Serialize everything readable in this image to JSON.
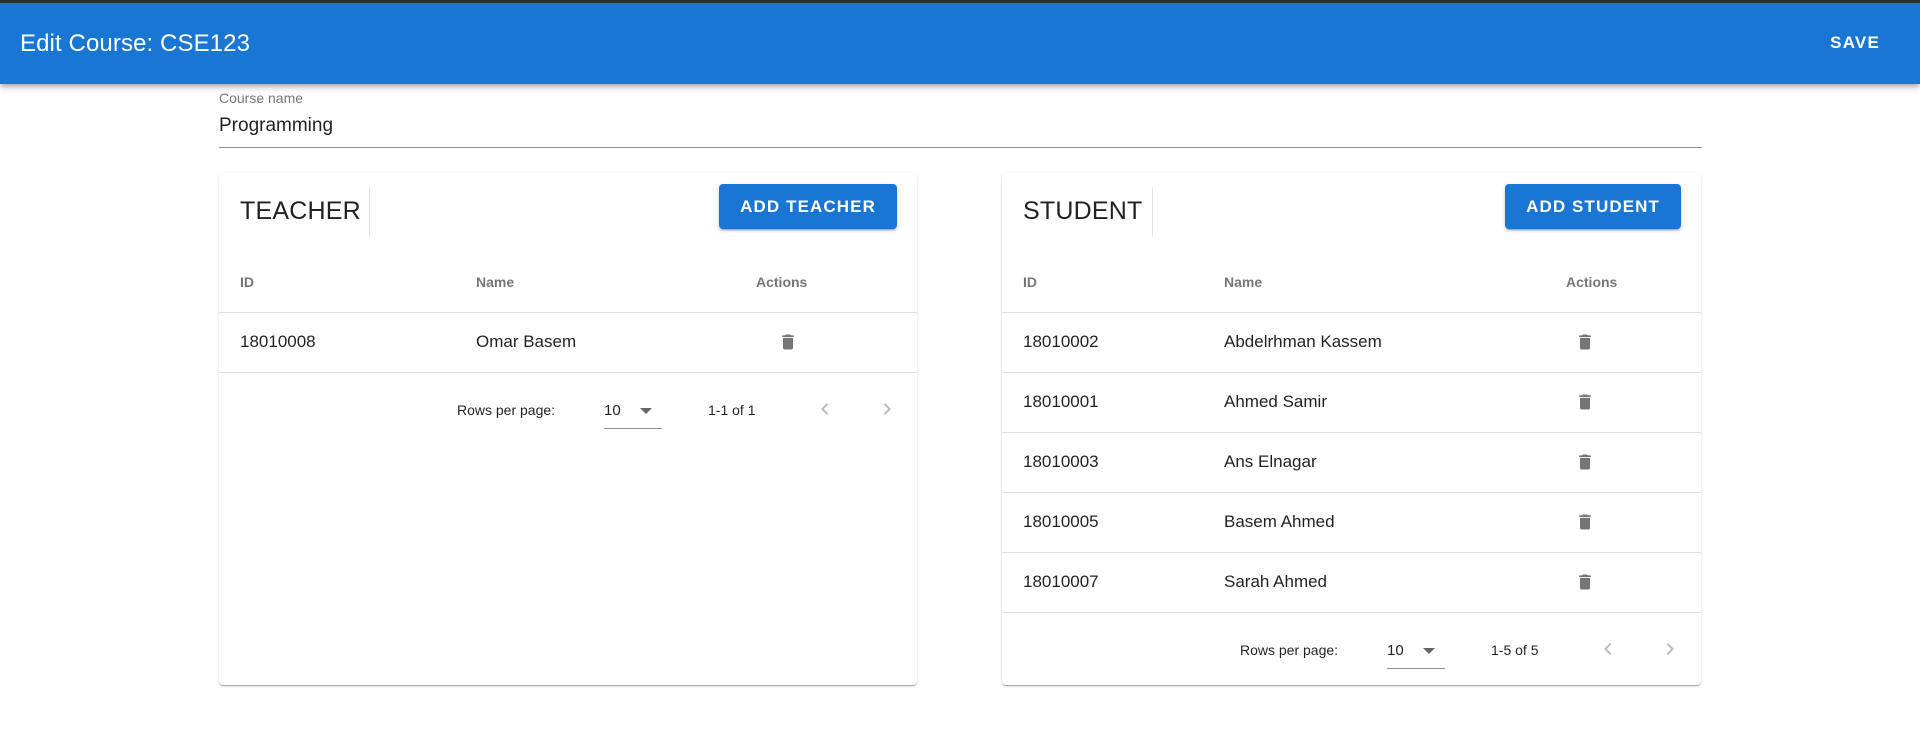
{
  "appbar": {
    "title": "Edit Course: CSE123",
    "save_label": "SAVE"
  },
  "course_field": {
    "label": "Course name",
    "value": "Programming"
  },
  "teacher_card": {
    "title": "TEACHER",
    "add_label": "ADD TEACHER",
    "columns": [
      "ID",
      "Name",
      "Actions"
    ],
    "rows": [
      {
        "id": "18010008",
        "name": "Omar Basem"
      }
    ],
    "pager": {
      "rows_per_page_label": "Rows per page:",
      "rows_per_page": "10",
      "range": "1-1 of 1"
    }
  },
  "student_card": {
    "title": "STUDENT",
    "add_label": "ADD STUDENT",
    "columns": [
      "ID",
      "Name",
      "Actions"
    ],
    "rows": [
      {
        "id": "18010002",
        "name": "Abdelrhman Kassem"
      },
      {
        "id": "18010001",
        "name": "Ahmed Samir"
      },
      {
        "id": "18010003",
        "name": "Ans Elnagar"
      },
      {
        "id": "18010005",
        "name": "Basem Ahmed"
      },
      {
        "id": "18010007",
        "name": "Sarah Ahmed"
      }
    ],
    "pager": {
      "rows_per_page_label": "Rows per page:",
      "rows_per_page": "10",
      "range": "1-5 of 5"
    }
  },
  "icons": {
    "delete": "trash-icon",
    "prev": "chevron-left-icon",
    "next": "chevron-right-icon",
    "dropdown": "caret-down-icon"
  },
  "colors": {
    "primary": "#1976d2",
    "icon": "#757575",
    "disabled": "#bdbdbd"
  }
}
